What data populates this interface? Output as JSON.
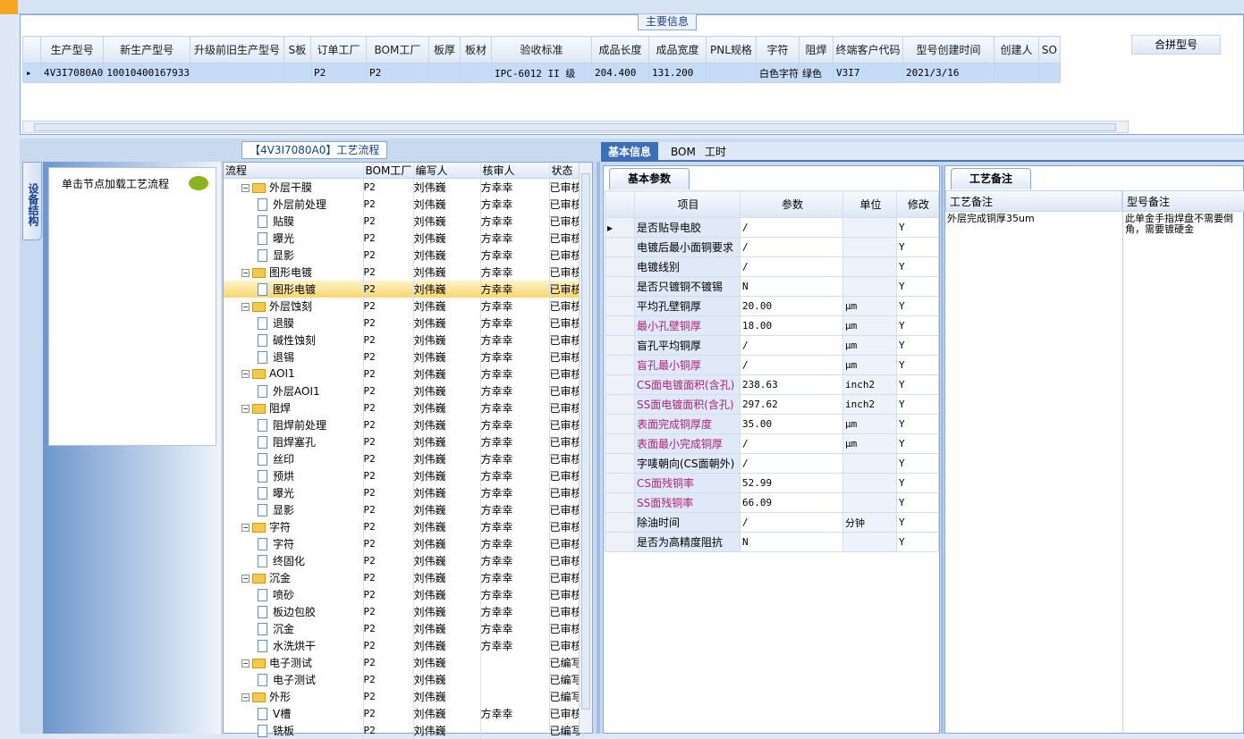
{
  "main_info": {
    "title": "主要信息",
    "columns": [
      "生产型号",
      "新生产型号",
      "升级前旧生产型号",
      "S板",
      "订单工厂",
      "BOM工厂",
      "板厚",
      "板材",
      "验收标准",
      "成品长度",
      "成品宽度",
      "PNL规格",
      "字符",
      "阻焊",
      "终端客户代码",
      "型号创建时间",
      "创建人",
      "SO"
    ],
    "row": [
      "4V3I7080A0",
      "10010400167933",
      "",
      "",
      "P2",
      "P2",
      "",
      "",
      "IPC-6012 II 级",
      "204.400",
      "131.200",
      "",
      "白色字符",
      "绿色",
      "V3I7",
      "2021/3/16",
      "",
      ""
    ],
    "merge_columns": [
      "合拼型号",
      ""
    ]
  },
  "left_panel": {
    "vertical_tab": "设备结构",
    "load_hint": "单击节点加载工艺流程"
  },
  "flow": {
    "title": "【4V3I7080A0】工艺流程",
    "columns": [
      "流程",
      "BOM工厂",
      "编写人",
      "核审人",
      "状态"
    ],
    "rows": [
      {
        "name": "外层干膜",
        "level": 0,
        "bom": "P2",
        "writer": "刘伟巍",
        "reviewer": "方幸幸",
        "status": "已审核"
      },
      {
        "name": "外层前处理",
        "level": 1,
        "bom": "P2",
        "writer": "刘伟巍",
        "reviewer": "方幸幸",
        "status": "已审核"
      },
      {
        "name": "贴膜",
        "level": 1,
        "bom": "P2",
        "writer": "刘伟巍",
        "reviewer": "方幸幸",
        "status": "已审核"
      },
      {
        "name": "曝光",
        "level": 1,
        "bom": "P2",
        "writer": "刘伟巍",
        "reviewer": "方幸幸",
        "status": "已审核"
      },
      {
        "name": "显影",
        "level": 1,
        "bom": "P2",
        "writer": "刘伟巍",
        "reviewer": "方幸幸",
        "status": "已审核"
      },
      {
        "name": "图形电镀",
        "level": 0,
        "bom": "P2",
        "writer": "刘伟巍",
        "reviewer": "方幸幸",
        "status": "已审核"
      },
      {
        "name": "图形电镀",
        "level": 1,
        "bom": "P2",
        "writer": "刘伟巍",
        "reviewer": "方幸幸",
        "status": "已审核",
        "selected": true
      },
      {
        "name": "外层蚀刻",
        "level": 0,
        "bom": "P2",
        "writer": "刘伟巍",
        "reviewer": "方幸幸",
        "status": "已审核"
      },
      {
        "name": "退膜",
        "level": 1,
        "bom": "P2",
        "writer": "刘伟巍",
        "reviewer": "方幸幸",
        "status": "已审核"
      },
      {
        "name": "碱性蚀刻",
        "level": 1,
        "bom": "P2",
        "writer": "刘伟巍",
        "reviewer": "方幸幸",
        "status": "已审核"
      },
      {
        "name": "退锡",
        "level": 1,
        "bom": "P2",
        "writer": "刘伟巍",
        "reviewer": "方幸幸",
        "status": "已审核"
      },
      {
        "name": "AOI1",
        "level": 0,
        "bom": "P2",
        "writer": "刘伟巍",
        "reviewer": "方幸幸",
        "status": "已审核"
      },
      {
        "name": "外层AOI1",
        "level": 1,
        "bom": "P2",
        "writer": "刘伟巍",
        "reviewer": "方幸幸",
        "status": "已审核"
      },
      {
        "name": "阻焊",
        "level": 0,
        "bom": "P2",
        "writer": "刘伟巍",
        "reviewer": "方幸幸",
        "status": "已审核"
      },
      {
        "name": "阻焊前处理",
        "level": 1,
        "bom": "P2",
        "writer": "刘伟巍",
        "reviewer": "方幸幸",
        "status": "已审核"
      },
      {
        "name": "阻焊塞孔",
        "level": 1,
        "bom": "P2",
        "writer": "刘伟巍",
        "reviewer": "方幸幸",
        "status": "已审核"
      },
      {
        "name": "丝印",
        "level": 1,
        "bom": "P2",
        "writer": "刘伟巍",
        "reviewer": "方幸幸",
        "status": "已审核"
      },
      {
        "name": "预烘",
        "level": 1,
        "bom": "P2",
        "writer": "刘伟巍",
        "reviewer": "方幸幸",
        "status": "已审核"
      },
      {
        "name": "曝光",
        "level": 1,
        "bom": "P2",
        "writer": "刘伟巍",
        "reviewer": "方幸幸",
        "status": "已审核"
      },
      {
        "name": "显影",
        "level": 1,
        "bom": "P2",
        "writer": "刘伟巍",
        "reviewer": "方幸幸",
        "status": "已审核"
      },
      {
        "name": "字符",
        "level": 0,
        "bom": "P2",
        "writer": "刘伟巍",
        "reviewer": "方幸幸",
        "status": "已审核"
      },
      {
        "name": "字符",
        "level": 1,
        "bom": "P2",
        "writer": "刘伟巍",
        "reviewer": "方幸幸",
        "status": "已审核"
      },
      {
        "name": "终固化",
        "level": 1,
        "bom": "P2",
        "writer": "刘伟巍",
        "reviewer": "方幸幸",
        "status": "已审核"
      },
      {
        "name": "沉金",
        "level": 0,
        "bom": "P2",
        "writer": "刘伟巍",
        "reviewer": "方幸幸",
        "status": "已审核"
      },
      {
        "name": "喷砂",
        "level": 1,
        "bom": "P2",
        "writer": "刘伟巍",
        "reviewer": "方幸幸",
        "status": "已审核"
      },
      {
        "name": "板边包胶",
        "level": 1,
        "bom": "P2",
        "writer": "刘伟巍",
        "reviewer": "方幸幸",
        "status": "已审核"
      },
      {
        "name": "沉金",
        "level": 1,
        "bom": "P2",
        "writer": "刘伟巍",
        "reviewer": "方幸幸",
        "status": "已审核"
      },
      {
        "name": "水洗烘干",
        "level": 1,
        "bom": "P2",
        "writer": "刘伟巍",
        "reviewer": "方幸幸",
        "status": "已审核"
      },
      {
        "name": "电子测试",
        "level": 0,
        "bom": "P2",
        "writer": "刘伟巍",
        "reviewer": "",
        "status": "已编写"
      },
      {
        "name": "电子测试",
        "level": 1,
        "bom": "P2",
        "writer": "刘伟巍",
        "reviewer": "",
        "status": "已编写"
      },
      {
        "name": "外形",
        "level": 0,
        "bom": "P2",
        "writer": "刘伟巍",
        "reviewer": "",
        "status": "已编写"
      },
      {
        "name": "V槽",
        "level": 1,
        "bom": "P2",
        "writer": "刘伟巍",
        "reviewer": "方幸幸",
        "status": "已审核"
      },
      {
        "name": "铣板",
        "level": 1,
        "bom": "P2",
        "writer": "刘伟巍",
        "reviewer": "",
        "status": "已编写"
      }
    ]
  },
  "right_tabs": [
    "基本信息",
    "BOM",
    "工时"
  ],
  "basic_params": {
    "tab": "基本参数",
    "columns": [
      "项目",
      "参数",
      "单位",
      "修改"
    ],
    "rows": [
      {
        "item": "是否贴导电胶",
        "param": "/",
        "unit": "",
        "mod": "Y",
        "pink": false
      },
      {
        "item": "电镀后最小面铜要求",
        "param": "/",
        "unit": "",
        "mod": "Y",
        "pink": false
      },
      {
        "item": "电镀线别",
        "param": "/",
        "unit": "",
        "mod": "Y",
        "pink": false
      },
      {
        "item": "是否只镀铜不镀锡",
        "param": "N",
        "unit": "",
        "mod": "Y",
        "pink": false
      },
      {
        "item": "平均孔壁铜厚",
        "param": "20.00",
        "unit": "μm",
        "mod": "Y",
        "pink": false
      },
      {
        "item": "最小孔壁铜厚",
        "param": "18.00",
        "unit": "μm",
        "mod": "Y",
        "pink": true
      },
      {
        "item": "盲孔平均铜厚",
        "param": "/",
        "unit": "μm",
        "mod": "Y",
        "pink": false
      },
      {
        "item": "盲孔最小铜厚",
        "param": "/",
        "unit": "μm",
        "mod": "Y",
        "pink": true
      },
      {
        "item": "CS面电镀面积(含孔)",
        "param": "238.63",
        "unit": "inch2",
        "mod": "Y",
        "pink": true
      },
      {
        "item": "SS面电镀面积(含孔)",
        "param": "297.62",
        "unit": "inch2",
        "mod": "Y",
        "pink": true
      },
      {
        "item": "表面完成铜厚度",
        "param": "35.00",
        "unit": "μm",
        "mod": "Y",
        "pink": true
      },
      {
        "item": "表面最小完成铜厚",
        "param": "/",
        "unit": "μm",
        "mod": "Y",
        "pink": true
      },
      {
        "item": "字唛朝向(CS面朝外)",
        "param": "/",
        "unit": "",
        "mod": "Y",
        "pink": false
      },
      {
        "item": "CS面残铜率",
        "param": "52.99",
        "unit": "",
        "mod": "Y",
        "pink": true
      },
      {
        "item": "SS面残铜率",
        "param": "66.09",
        "unit": "",
        "mod": "Y",
        "pink": true
      },
      {
        "item": "除油时间",
        "param": "/",
        "unit": "分钟",
        "mod": "Y",
        "pink": false
      },
      {
        "item": "是否为高精度阻抗",
        "param": "N",
        "unit": "",
        "mod": "Y",
        "pink": false
      }
    ]
  },
  "notes": {
    "tab": "工艺备注",
    "process_header": "工艺备注",
    "model_header": "型号备注",
    "process_note": "外层完成铜厚35um",
    "model_note": "此单金手指焊盘不需要倒角，需要镀硬金"
  },
  "colors": {
    "accent": "#3d6fb6",
    "selected_row": "#c6dcf6",
    "highlight": "#f7d66e",
    "pink_text": "#b0207a"
  }
}
